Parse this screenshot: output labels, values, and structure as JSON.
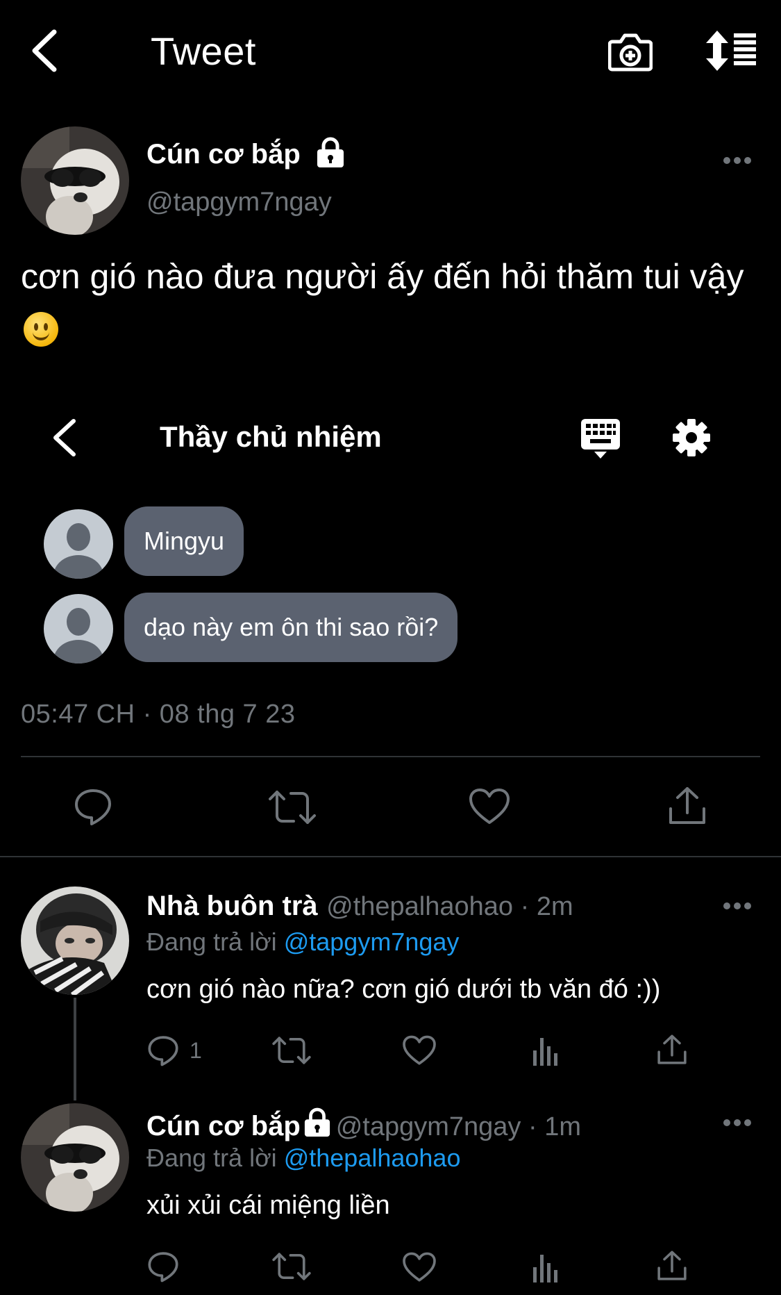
{
  "header": {
    "title": "Tweet",
    "back_icon": "chevron-left-icon",
    "camera_icon": "camera-plus-icon",
    "sort_icon": "sort-list-icon"
  },
  "main_tweet": {
    "author_name": "Cún cơ bắp",
    "author_handle": "@tapgym7ngay",
    "text": "cơn gió nào đưa người ấy đến hỏi thăm tui vậy",
    "emoji": "slightly-smiling-face",
    "timestamp": "05:47 CH · 08 thg 7 23"
  },
  "embedded_chat": {
    "title": "Thầy chủ nhiệm",
    "messages": [
      {
        "text": "Mingyu"
      },
      {
        "text": "dạo này em ôn thi sao rồi?"
      }
    ]
  },
  "replies": [
    {
      "author_name": "Nhà buôn trà",
      "author_handle": "@thepalhaohao",
      "time": "2m",
      "replying_to_label": "Đang trả lời",
      "replying_to": "@tapgym7ngay",
      "text": "cơn gió nào nữa? cơn gió dưới tb văn đó :))",
      "reply_count": "1"
    },
    {
      "author_name": "Cún cơ bắp",
      "author_handle": "@tapgym7ngay",
      "time": "1m",
      "replying_to_label": "Đang trả lời",
      "replying_to": "@thepalhaohao",
      "text": "xủi xủi cái miệng liền",
      "reply_count": ""
    }
  ],
  "colors": {
    "background": "#000000",
    "muted": "#71767b",
    "link": "#1d9bf0",
    "bubble": "#5b6270",
    "divider": "#2f3336"
  }
}
